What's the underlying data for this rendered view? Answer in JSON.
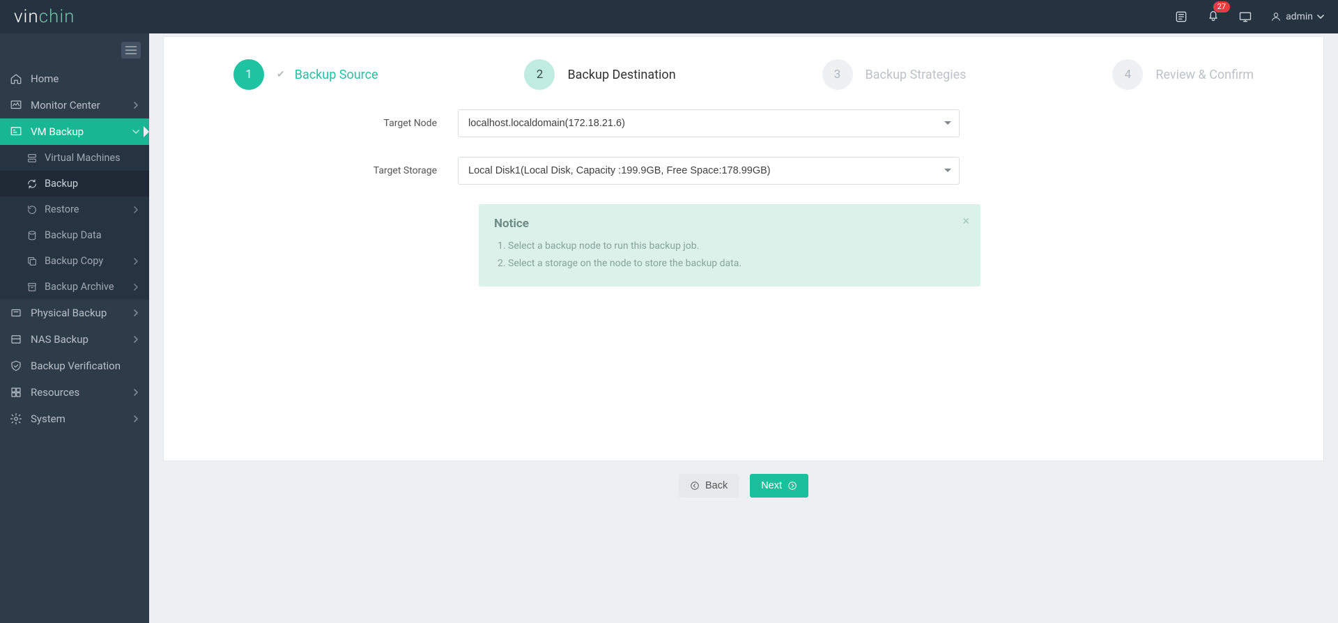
{
  "header": {
    "logo_vin": "vin",
    "logo_chin": "chin",
    "notifications_count": "27",
    "user_label": "admin"
  },
  "sidebar": {
    "home": "Home",
    "monitor_center": "Monitor Center",
    "vm_backup": "VM Backup",
    "vm_sub": {
      "virtual_machines": "Virtual Machines",
      "backup": "Backup",
      "restore": "Restore",
      "backup_data": "Backup Data",
      "backup_copy": "Backup Copy",
      "backup_archive": "Backup Archive"
    },
    "physical_backup": "Physical Backup",
    "nas_backup": "NAS Backup",
    "backup_verification": "Backup Verification",
    "resources": "Resources",
    "system": "System"
  },
  "wizard": {
    "step1": {
      "num": "1",
      "label": "Backup Source"
    },
    "step2": {
      "num": "2",
      "label": "Backup Destination"
    },
    "step3": {
      "num": "3",
      "label": "Backup Strategies"
    },
    "step4": {
      "num": "4",
      "label": "Review & Confirm"
    }
  },
  "form": {
    "target_node_label": "Target Node",
    "target_node_value": "localhost.localdomain(172.18.21.6)",
    "target_storage_label": "Target Storage",
    "target_storage_value": "Local Disk1(Local Disk, Capacity :199.9GB, Free Space:178.99GB)"
  },
  "notice": {
    "title": "Notice",
    "line1": "Select a backup node to run this backup job.",
    "line2": "Select a storage on the node to store the backup data."
  },
  "footer": {
    "back": "Back",
    "next": "Next"
  }
}
